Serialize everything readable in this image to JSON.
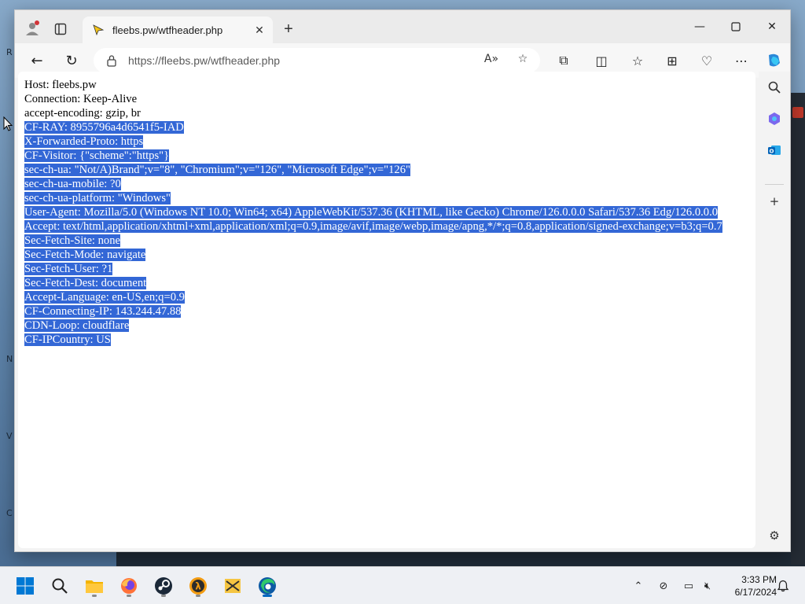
{
  "browser": {
    "tab_title": "fleebs.pw/wtfheader.php",
    "url": "https://fleebs.pw/wtfheader.php",
    "new_tab_icon": "plus-icon",
    "window_controls": [
      "minimize-icon",
      "maximize-icon",
      "close-icon"
    ]
  },
  "page": {
    "lines": [
      {
        "text": "Host: fleebs.pw",
        "selected": false
      },
      {
        "text": "Connection: Keep-Alive",
        "selected": false
      },
      {
        "text": "accept-encoding: gzip, br",
        "selected": false
      },
      {
        "text": "CF-RAY: 8955796a4d6541f5-IAD",
        "selected": true
      },
      {
        "text": "X-Forwarded-Proto: https",
        "selected": true
      },
      {
        "text": "CF-Visitor: {\"scheme\":\"https\"}",
        "selected": true
      },
      {
        "text": "sec-ch-ua: \"Not/A)Brand\";v=\"8\", \"Chromium\";v=\"126\", \"Microsoft Edge\";v=\"126\"",
        "selected": true
      },
      {
        "text": "sec-ch-ua-mobile: ?0",
        "selected": true
      },
      {
        "text": "sec-ch-ua-platform: \"Windows\"",
        "selected": true
      },
      {
        "text": "User-Agent: Mozilla/5.0 (Windows NT 10.0; Win64; x64) AppleWebKit/537.36 (KHTML, like Gecko) Chrome/126.0.0.0 Safari/537.36 Edg/126.0.0.0",
        "selected": true
      },
      {
        "text": "Accept: text/html,application/xhtml+xml,application/xml;q=0.9,image/avif,image/webp,image/apng,*/*;q=0.8,application/signed-exchange;v=b3;q=0.7",
        "selected": true
      },
      {
        "text": "Sec-Fetch-Site: none",
        "selected": true
      },
      {
        "text": "Sec-Fetch-Mode: navigate",
        "selected": true
      },
      {
        "text": "Sec-Fetch-User: ?1",
        "selected": true
      },
      {
        "text": "Sec-Fetch-Dest: document",
        "selected": true
      },
      {
        "text": "Accept-Language: en-US,en;q=0.9",
        "selected": true
      },
      {
        "text": "CF-Connecting-IP: 143.244.47.88",
        "selected": true
      },
      {
        "text": "CDN-Loop: cloudflare",
        "selected": true
      },
      {
        "text": "CF-IPCountry: US",
        "selected": true
      }
    ]
  },
  "colors": {
    "selection": "#3367d6",
    "accent": "#0067c0"
  },
  "taskbar": {
    "apps": [
      "windows-start-icon",
      "search-icon",
      "file-explorer-icon",
      "firefox-icon",
      "steam-icon",
      "half-life-icon",
      "folder-app-icon",
      "edge-icon"
    ],
    "time": "3:33 PM",
    "date": "6/17/2024"
  }
}
